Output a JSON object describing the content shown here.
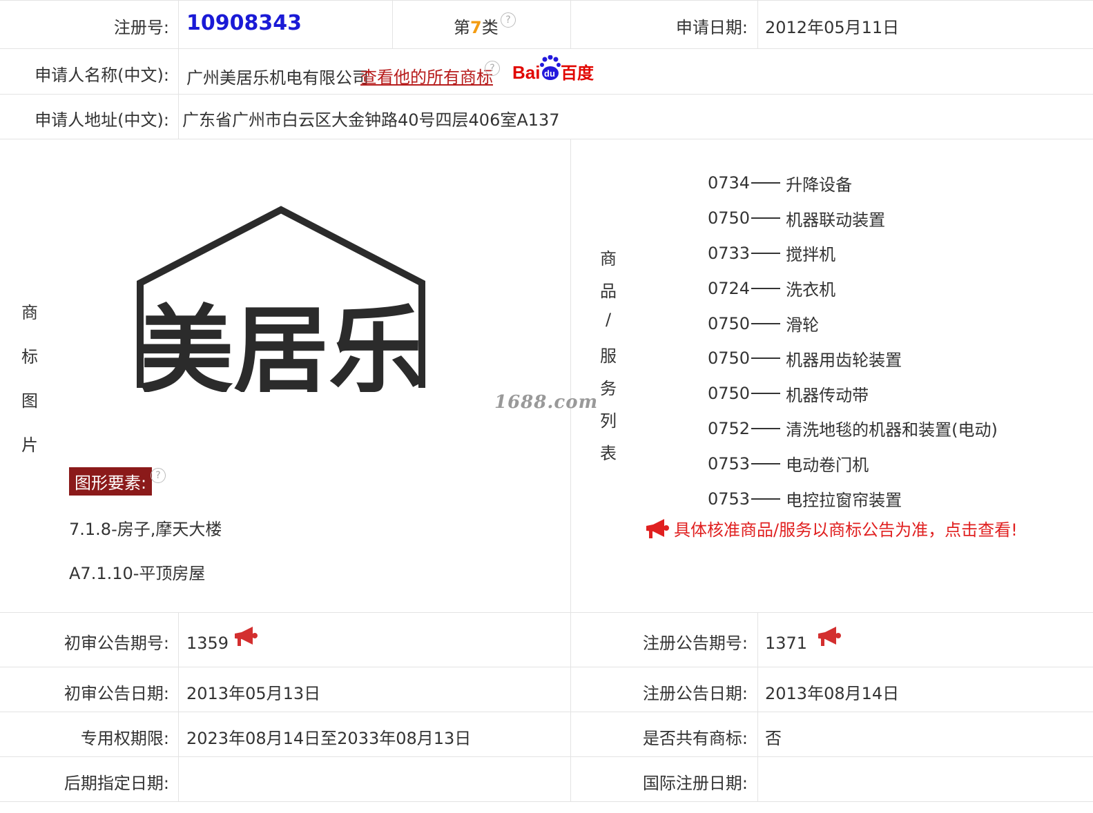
{
  "header": {
    "reg_no_label": "注册号:",
    "reg_no": "10908343",
    "class_prefix": "第",
    "class_no": "7",
    "class_suffix": "类",
    "apply_date_label": "申请日期:",
    "apply_date": "2012年05月11日"
  },
  "applicant": {
    "name_label": "申请人名称(中文):",
    "name": "广州美居乐机电有限公司",
    "view_all_link": "查看他的所有商标",
    "baidu_text_a": "Bai",
    "baidu_text_b": "du",
    "baidu_text_c": "百度",
    "address_label": "申请人地址(中文):",
    "address": "广东省广州市白云区大金钟路40号四层406室A137"
  },
  "trademark_image": {
    "side_label": [
      "商",
      "标",
      "图",
      "片"
    ],
    "logo_text": "美居乐",
    "watermark": "1688.com",
    "elements_label": "图形要素:",
    "elements": [
      "7.1.8-房子,摩天大楼",
      "A7.1.10-平顶房屋"
    ]
  },
  "goods": {
    "side_label": [
      "商",
      "品",
      "/",
      "服",
      "务",
      "列",
      "表"
    ],
    "items": [
      {
        "code": "0734",
        "name": "升降设备"
      },
      {
        "code": "0750",
        "name": "机器联动装置"
      },
      {
        "code": "0733",
        "name": "搅拌机"
      },
      {
        "code": "0724",
        "name": "洗衣机"
      },
      {
        "code": "0750",
        "name": "滑轮"
      },
      {
        "code": "0750",
        "name": "机器用齿轮装置"
      },
      {
        "code": "0750",
        "name": "机器传动带"
      },
      {
        "code": "0752",
        "name": "清洗地毯的机器和装置(电动)"
      },
      {
        "code": "0753",
        "name": "电动卷门机"
      },
      {
        "code": "0753",
        "name": "电控拉窗帘装置"
      }
    ],
    "notice": "具体核准商品/服务以商标公告为准，点击查看!"
  },
  "announcements": {
    "prelim_no_label": "初审公告期号:",
    "prelim_no": "1359",
    "reg_no_label": "注册公告期号:",
    "reg_no": "1371",
    "prelim_date_label": "初审公告日期:",
    "prelim_date": "2013年05月13日",
    "reg_date_label": "注册公告日期:",
    "reg_date": "2013年08月14日",
    "exclusive_label": "专用权期限:",
    "exclusive_period": "2023年08月14日至2033年08月13日",
    "shared_label": "是否共有商标:",
    "shared": "否",
    "later_label": "后期指定日期:",
    "later_date": "",
    "intl_label": "国际注册日期:",
    "intl_date": ""
  },
  "colors": {
    "reg_no": "#1a1ad6",
    "class_no": "#f39c12",
    "link": "#b71c1c",
    "notice": "#e02020",
    "element_tag_bg": "#8b1a1a",
    "baidu_red": "#e10601",
    "baidu_blue": "#2319dc"
  }
}
